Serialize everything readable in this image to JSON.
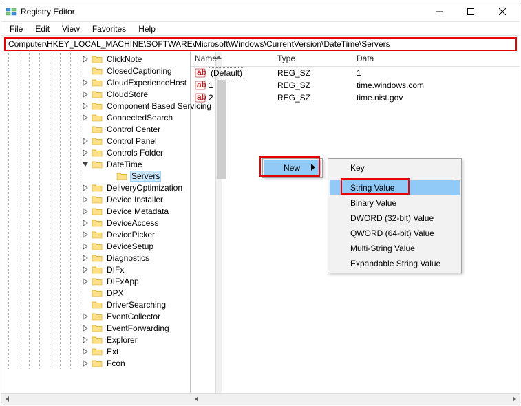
{
  "window": {
    "title": "Registry Editor"
  },
  "menu": {
    "items": [
      "File",
      "Edit",
      "View",
      "Favorites",
      "Help"
    ]
  },
  "address": {
    "path": "Computer\\HKEY_LOCAL_MACHINE\\SOFTWARE\\Microsoft\\Windows\\CurrentVersion\\DateTime\\Servers"
  },
  "tree": {
    "indent_base": 115,
    "items": [
      {
        "label": "ClickNote",
        "expander": "right"
      },
      {
        "label": "ClosedCaptioning",
        "expander": "none"
      },
      {
        "label": "CloudExperienceHost",
        "expander": "right"
      },
      {
        "label": "CloudStore",
        "expander": "right"
      },
      {
        "label": "Component Based Servicing",
        "expander": "right"
      },
      {
        "label": "ConnectedSearch",
        "expander": "right"
      },
      {
        "label": "Control Center",
        "expander": "none"
      },
      {
        "label": "Control Panel",
        "expander": "right"
      },
      {
        "label": "Controls Folder",
        "expander": "right"
      },
      {
        "label": "DateTime",
        "expander": "down"
      },
      {
        "label": "Servers",
        "expander": "none",
        "indent_extra": 36,
        "selected": true
      },
      {
        "label": "DeliveryOptimization",
        "expander": "right"
      },
      {
        "label": "Device Installer",
        "expander": "right"
      },
      {
        "label": "Device Metadata",
        "expander": "right"
      },
      {
        "label": "DeviceAccess",
        "expander": "right"
      },
      {
        "label": "DevicePicker",
        "expander": "right"
      },
      {
        "label": "DeviceSetup",
        "expander": "right"
      },
      {
        "label": "Diagnostics",
        "expander": "right"
      },
      {
        "label": "DIFx",
        "expander": "right"
      },
      {
        "label": "DIFxApp",
        "expander": "right"
      },
      {
        "label": "DPX",
        "expander": "none"
      },
      {
        "label": "DriverSearching",
        "expander": "none"
      },
      {
        "label": "EventCollector",
        "expander": "right"
      },
      {
        "label": "EventForwarding",
        "expander": "right"
      },
      {
        "label": "Explorer",
        "expander": "right"
      },
      {
        "label": "Ext",
        "expander": "right"
      },
      {
        "label": "Fcon",
        "expander": "right"
      }
    ]
  },
  "list": {
    "columns": {
      "name": "Name",
      "type": "Type",
      "data": "Data"
    },
    "rows": [
      {
        "name": "(Default)",
        "type": "REG_SZ",
        "data": "1",
        "default": true
      },
      {
        "name": "1",
        "type": "REG_SZ",
        "data": "time.windows.com",
        "default": false
      },
      {
        "name": "2",
        "type": "REG_SZ",
        "data": "time.nist.gov",
        "default": false
      }
    ]
  },
  "context_menu": {
    "parent_label": "New",
    "sub": [
      {
        "label": "Key",
        "kind": "item"
      },
      {
        "kind": "sep"
      },
      {
        "label": "String Value",
        "kind": "item",
        "highlight": true
      },
      {
        "label": "Binary Value",
        "kind": "item"
      },
      {
        "label": "DWORD (32-bit) Value",
        "kind": "item"
      },
      {
        "label": "QWORD (64-bit) Value",
        "kind": "item"
      },
      {
        "label": "Multi-String Value",
        "kind": "item"
      },
      {
        "label": "Expandable String Value",
        "kind": "item"
      }
    ]
  }
}
